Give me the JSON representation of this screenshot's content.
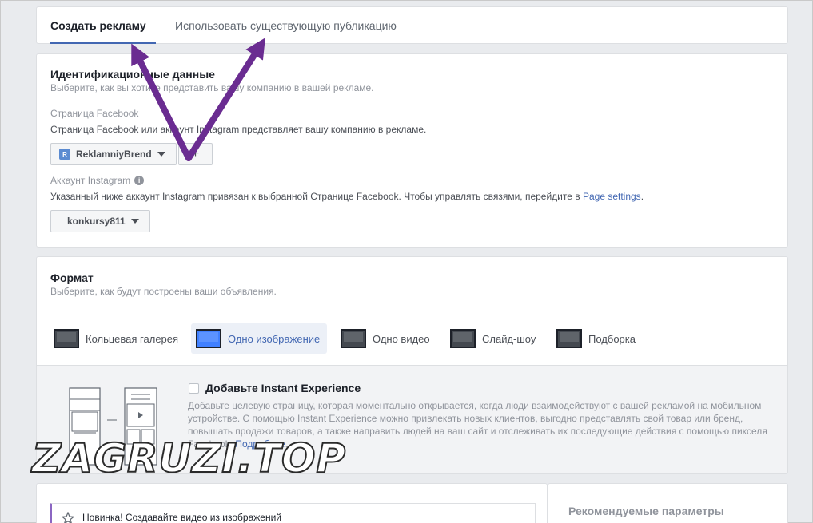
{
  "tabs": [
    {
      "label": "Создать рекламу",
      "active": true
    },
    {
      "label": "Использовать существующую публикацию",
      "active": false
    }
  ],
  "identity": {
    "title": "Идентификационные данные",
    "subtitle": "Выберите, как вы хотите представить вашу компанию в вашей рекламе.",
    "facebook_page": {
      "label": "Страница Facebook",
      "description": "Страница Facebook или аккаунт Instagram представляет вашу компанию в рекламе.",
      "avatar_letter": "R",
      "selected": "ReklamniyBrend",
      "add_button": "+"
    },
    "instagram": {
      "label": "Аккаунт Instagram",
      "info_icon": "i",
      "description": "Указанный ниже аккаунт Instagram привязан к выбранной Странице Facebook. Чтобы управлять связями, перейдите в",
      "link": "Page settings",
      "link_suffix": ".",
      "selected": "konkursy811"
    }
  },
  "format": {
    "title": "Формат",
    "subtitle": "Выберите, как будут построены ваши объявления.",
    "options": [
      {
        "label": "Кольцевая галерея",
        "icon": "carousel-icon",
        "selected": false
      },
      {
        "label": "Одно изображение",
        "icon": "single-image-icon",
        "selected": true
      },
      {
        "label": "Одно видео",
        "icon": "single-video-icon",
        "selected": false
      },
      {
        "label": "Слайд-шоу",
        "icon": "slideshow-icon",
        "selected": false
      },
      {
        "label": "Подборка",
        "icon": "collection-icon",
        "selected": false
      }
    ],
    "instant_experience": {
      "checkbox_label": "Добавьте Instant Experience",
      "checked": false,
      "description": "Добавьте целевую страницу, которая моментально открывается, когда люди взаимодействуют с вашей рекламой на мобильном устройстве. С помощью Instant Experience можно привлекать новых клиентов, выгодно представлять свой товар или бренд, повышать продажи товаров, а также направить людей на ваш сайт и отслеживать их последующие действия с помощью пикселя Facebook.",
      "link": "Подробнее",
      "link_suffix": "."
    }
  },
  "bottom": {
    "new_banner": "Новинка! Создавайте видео из изображений",
    "recommended_title": "Рекомендуемые параметры"
  },
  "watermark": "ZAGRUZI.TOP",
  "colors": {
    "accent": "#4267b2",
    "arrow": "#6a2c91",
    "page_bg": "#e9ebee"
  }
}
